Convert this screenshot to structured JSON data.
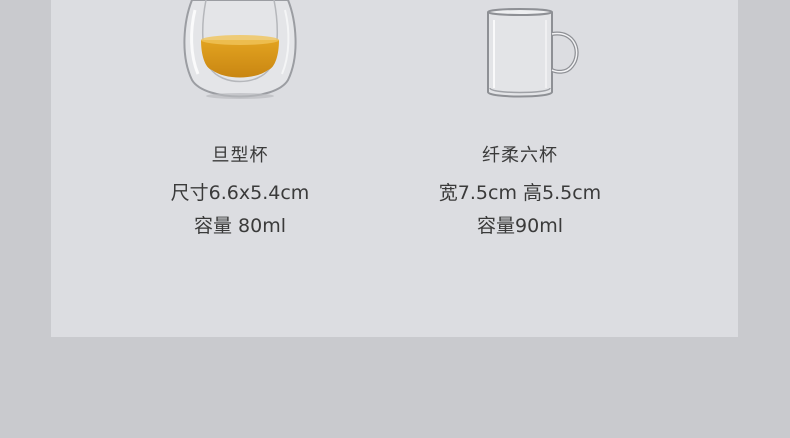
{
  "products": [
    {
      "name": "旦型杯",
      "size": "尺寸6.6x5.4cm",
      "capacity": "容量 80ml"
    },
    {
      "name": "纤柔六杯",
      "size": "宽7.5cm 高5.5cm",
      "capacity": "容量90ml"
    }
  ]
}
